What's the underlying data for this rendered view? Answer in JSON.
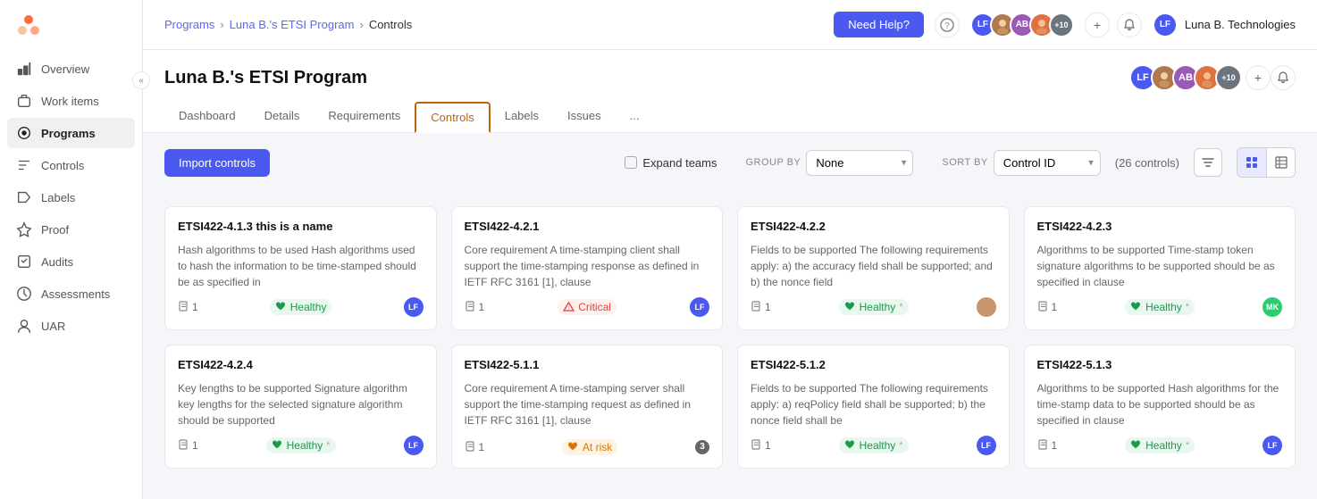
{
  "sidebar": {
    "collapse_label": "«",
    "items": [
      {
        "id": "overview",
        "label": "Overview",
        "active": false
      },
      {
        "id": "work-items",
        "label": "Work items",
        "active": false
      },
      {
        "id": "programs",
        "label": "Programs",
        "active": true
      },
      {
        "id": "controls",
        "label": "Controls",
        "active": false
      },
      {
        "id": "labels",
        "label": "Labels",
        "active": false
      },
      {
        "id": "proof",
        "label": "Proof",
        "active": false
      },
      {
        "id": "audits",
        "label": "Audits",
        "active": false
      },
      {
        "id": "assessments",
        "label": "Assessments",
        "active": false
      },
      {
        "id": "uar",
        "label": "UAR",
        "active": false
      }
    ]
  },
  "topbar": {
    "breadcrumb": {
      "programs": "Programs",
      "program_name": "Luna B.'s ETSI Program",
      "current": "Controls"
    },
    "need_help_label": "Need Help?",
    "user_name": "Luna B. Technologies",
    "avatar_plus": "+10"
  },
  "page": {
    "title": "Luna B.'s ETSI Program",
    "tabs": [
      {
        "id": "dashboard",
        "label": "Dashboard",
        "active": false
      },
      {
        "id": "details",
        "label": "Details",
        "active": false
      },
      {
        "id": "requirements",
        "label": "Requirements",
        "active": false
      },
      {
        "id": "controls",
        "label": "Controls",
        "active": true
      },
      {
        "id": "labels",
        "label": "Labels",
        "active": false
      },
      {
        "id": "issues",
        "label": "Issues",
        "active": false
      },
      {
        "id": "more",
        "label": "...",
        "active": false
      }
    ]
  },
  "toolbar": {
    "import_label": "Import controls",
    "expand_teams_label": "Expand teams",
    "group_by_label": "GROUP BY",
    "group_by_value": "None",
    "sort_by_label": "SORT BY",
    "sort_by_value": "Control ID",
    "controls_count": "(26 controls)"
  },
  "cards": [
    {
      "id": "ETSI422-4.1.3",
      "title": "ETSI422-4.1.3 this is a name",
      "desc": "Hash algorithms to be used Hash algorithms used to hash the information to be time-stamped should be as specified in",
      "count": 1,
      "status": "Healthy",
      "status_type": "healthy",
      "avatar_bg": "#4a5af0",
      "avatar_text": "LF",
      "has_asterisk": false
    },
    {
      "id": "ETSI422-4.2.1",
      "title": "ETSI422-4.2.1",
      "desc": "Core requirement A time-stamping client shall support the time-stamping response as defined in IETF RFC 3161 [1], clause",
      "count": 1,
      "status": "Critical",
      "status_type": "critical",
      "avatar_bg": "#4a5af0",
      "avatar_text": "LF",
      "has_asterisk": false
    },
    {
      "id": "ETSI422-4.2.2",
      "title": "ETSI422-4.2.2",
      "desc": "Fields to be supported The following requirements apply: a) the accuracy field shall be supported; and b) the nonce field",
      "count": 1,
      "status": "Healthy",
      "status_type": "healthy",
      "avatar_bg": "#c8956c",
      "avatar_text": "",
      "has_asterisk": true,
      "avatar_is_img": true
    },
    {
      "id": "ETSI422-4.2.3",
      "title": "ETSI422-4.2.3",
      "desc": "Algorithms to be supported Time-stamp token signature algorithms to be supported should be as specified in clause",
      "count": 1,
      "status": "Healthy",
      "status_type": "healthy",
      "avatar_bg": "#2ecc71",
      "avatar_text": "MK",
      "has_asterisk": true
    },
    {
      "id": "ETSI422-4.2.4",
      "title": "ETSI422-4.2.4",
      "desc": "Key lengths to be supported Signature algorithm key lengths for the selected signature algorithm should be supported",
      "count": 1,
      "status": "Healthy",
      "status_type": "healthy",
      "avatar_bg": "#4a5af0",
      "avatar_text": "LF",
      "has_asterisk": true
    },
    {
      "id": "ETSI422-5.1.1",
      "title": "ETSI422-5.1.1",
      "desc": "Core requirement A time-stamping server shall support the time-stamping request as defined in IETF RFC 3161 [1], clause",
      "count": 1,
      "status": "At risk",
      "status_type": "at-risk",
      "count_badge": 3,
      "avatar_bg": "#f0a500",
      "avatar_text": "3",
      "has_asterisk": false,
      "show_count_badge": true
    },
    {
      "id": "ETSI422-5.1.2",
      "title": "ETSI422-5.1.2",
      "desc": "Fields to be supported The following requirements apply: a) reqPolicy field shall be supported; b) the nonce field shall be",
      "count": 1,
      "status": "Healthy",
      "status_type": "healthy",
      "avatar_bg": "#4a5af0",
      "avatar_text": "LF",
      "has_asterisk": true
    },
    {
      "id": "ETSI422-5.1.3",
      "title": "ETSI422-5.1.3",
      "desc": "Algorithms to be supported Hash algorithms for the time-stamp data to be supported should be as specified in clause",
      "count": 1,
      "status": "Healthy",
      "status_type": "healthy",
      "avatar_bg": "#4a5af0",
      "avatar_text": "LF",
      "has_asterisk": true
    }
  ]
}
